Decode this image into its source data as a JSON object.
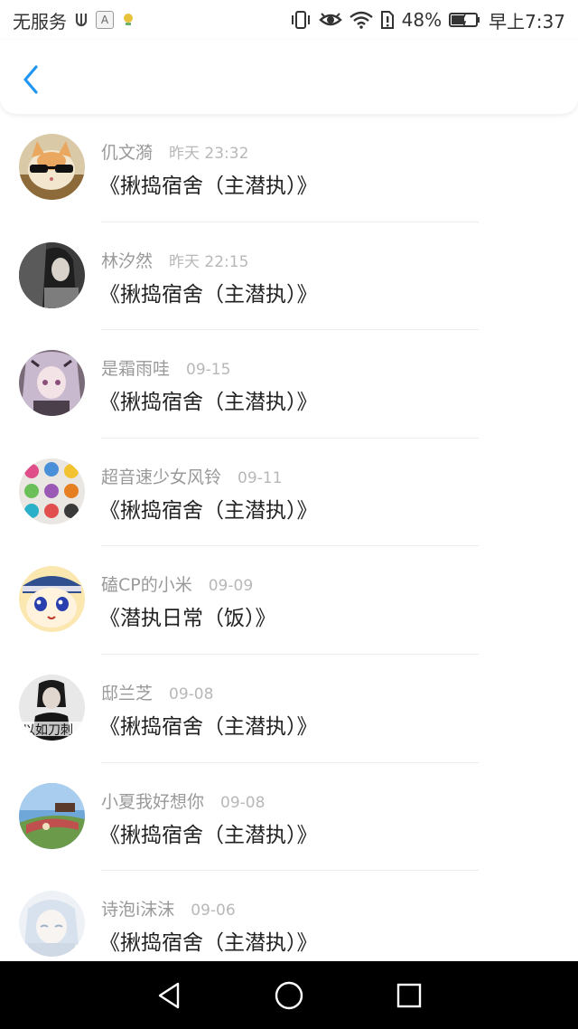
{
  "status_bar": {
    "carrier": "无服务",
    "battery_percent": "48%",
    "time": "早上7:37",
    "icons": [
      "usb-icon",
      "a-badge-icon",
      "notification-icon",
      "vibrate-icon",
      "eye-icon",
      "wifi-icon",
      "sim-alert-icon",
      "battery-icon"
    ]
  },
  "header": {
    "back_icon": "chevron-left-icon",
    "accent_color": "#2196f3"
  },
  "messages": [
    {
      "name": "仉文漪",
      "time": "昨天 23:32",
      "title": "《揪捣宿舍（主潜执）》"
    },
    {
      "name": "林汐然",
      "time": "昨天 22:15",
      "title": "《揪捣宿舍（主潜执）》"
    },
    {
      "name": "是霜雨哇",
      "time": "09-15",
      "title": "《揪捣宿舍（主潜执）》"
    },
    {
      "name": "超音速少女风铃",
      "time": "09-11",
      "title": "《揪捣宿舍（主潜执）》"
    },
    {
      "name": "磕CP的小米",
      "time": "09-09",
      "title": "《潜执日常（饭）》"
    },
    {
      "name": "邸兰芝",
      "time": "09-08",
      "title": "《揪捣宿舍（主潜执）》"
    },
    {
      "name": "小夏我好想你",
      "time": "09-08",
      "title": "《揪捣宿舍（主潜执）》"
    },
    {
      "name": "诗泡i沫沫",
      "time": "09-06",
      "title": "《揪捣宿舍（主潜执）》"
    }
  ],
  "nav_bar": {
    "icons": [
      "back-triangle-icon",
      "home-circle-icon",
      "recents-square-icon"
    ]
  }
}
